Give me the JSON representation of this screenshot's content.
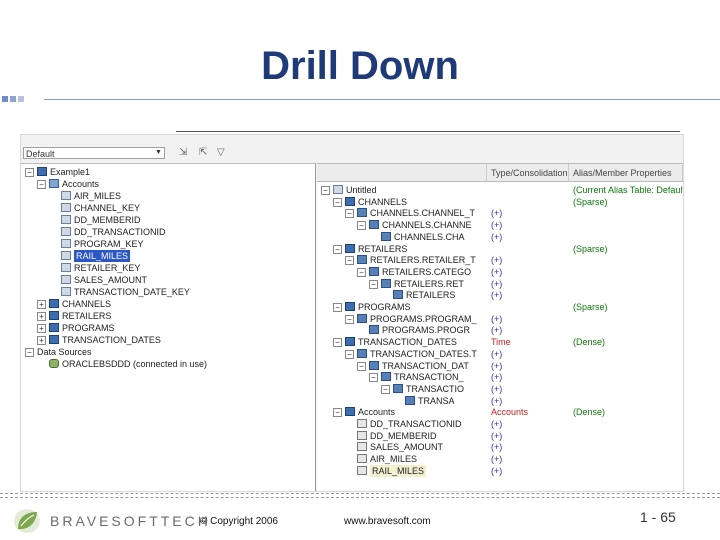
{
  "slide": {
    "title": "Drill Down",
    "colors": {
      "title": "#1f3a78",
      "squares": [
        "#6f8bc6",
        "#8fa4cf",
        "#b7c3de"
      ]
    }
  },
  "editor": {
    "dropdown_value": "Default",
    "toolbar_icons": [
      "expand-icon",
      "collapse-icon",
      "filter-icon"
    ],
    "left_tree": [
      {
        "label": "Example1",
        "level": 0,
        "icon": "cube-icon",
        "exp": "-"
      },
      {
        "label": "Accounts",
        "level": 1,
        "icon": "dimension-icon",
        "exp": "-"
      },
      {
        "label": "AIR_MILES",
        "level": 2,
        "icon": "member-icon"
      },
      {
        "label": "CHANNEL_KEY",
        "level": 2,
        "icon": "member-icon"
      },
      {
        "label": "DD_MEMBERID",
        "level": 2,
        "icon": "member-icon"
      },
      {
        "label": "DD_TRANSACTIONID",
        "level": 2,
        "icon": "member-icon"
      },
      {
        "label": "PROGRAM_KEY",
        "level": 2,
        "icon": "member-icon"
      },
      {
        "label": "RAIL_MILES",
        "level": 2,
        "icon": "member-icon",
        "selected": true
      },
      {
        "label": "RETAILER_KEY",
        "level": 2,
        "icon": "member-icon"
      },
      {
        "label": "SALES_AMOUNT",
        "level": 2,
        "icon": "member-icon"
      },
      {
        "label": "TRANSACTION_DATE_KEY",
        "level": 2,
        "icon": "member-icon"
      },
      {
        "label": "CHANNELS",
        "level": 1,
        "icon": "cube-icon",
        "exp": "+"
      },
      {
        "label": "RETAILERS",
        "level": 1,
        "icon": "cube-icon",
        "exp": "+"
      },
      {
        "label": "PROGRAMS",
        "level": 1,
        "icon": "cube-icon",
        "exp": "+"
      },
      {
        "label": "TRANSACTION_DATES",
        "level": 1,
        "icon": "cube-icon",
        "exp": "+"
      },
      {
        "label": "Data Sources",
        "level": 0,
        "icon": "",
        "exp": "-"
      },
      {
        "label": "ORACLEBSDDD (connected in use)",
        "level": 1,
        "icon": "database-icon"
      }
    ],
    "right_header": {
      "name": "",
      "type": "Type/Consolidation",
      "alias": "Alias/Member Properties"
    },
    "right_tree": [
      {
        "label": "Untitled",
        "level": 0,
        "icon": "outline-icon",
        "exp": "-",
        "type": "",
        "alias": "(Current Alias Table: Default)"
      },
      {
        "label": "CHANNELS",
        "level": 1,
        "icon": "cube-icon",
        "exp": "-",
        "type": "",
        "alias": "(Sparse)"
      },
      {
        "label": "CHANNELS.CHANNEL_T",
        "level": 2,
        "icon": "level-icon",
        "exp": "-",
        "type": "(+)",
        "alias": ""
      },
      {
        "label": "CHANNELS.CHANNE",
        "level": 3,
        "icon": "level-icon",
        "exp": "-",
        "type": "(+)",
        "alias": ""
      },
      {
        "label": "CHANNELS.CHA",
        "level": 4,
        "icon": "level-icon",
        "type": "(+)",
        "alias": ""
      },
      {
        "label": "RETAILERS",
        "level": 1,
        "icon": "cube-icon",
        "exp": "-",
        "type": "",
        "alias": "(Sparse)"
      },
      {
        "label": "RETAILERS.RETAILER_T",
        "level": 2,
        "icon": "level-icon",
        "exp": "-",
        "type": "(+)",
        "alias": ""
      },
      {
        "label": "RETAILERS.CATEGO",
        "level": 3,
        "icon": "level-icon",
        "exp": "-",
        "type": "(+)",
        "alias": ""
      },
      {
        "label": "RETAILERS.RET",
        "level": 4,
        "icon": "level-icon",
        "exp": "-",
        "type": "(+)",
        "alias": ""
      },
      {
        "label": "RETAILERS",
        "level": 5,
        "icon": "level-icon",
        "type": "(+)",
        "alias": ""
      },
      {
        "label": "PROGRAMS",
        "level": 1,
        "icon": "cube-icon",
        "exp": "-",
        "type": "",
        "alias": "(Sparse)"
      },
      {
        "label": "PROGRAMS.PROGRAM_",
        "level": 2,
        "icon": "level-icon",
        "exp": "-",
        "type": "(+)",
        "alias": ""
      },
      {
        "label": "PROGRAMS.PROGR",
        "level": 3,
        "icon": "level-icon",
        "type": "(+)",
        "alias": ""
      },
      {
        "label": "TRANSACTION_DATES",
        "level": 1,
        "icon": "cube-icon",
        "exp": "-",
        "type": "Time",
        "typeRed": true,
        "alias": "(Dense)"
      },
      {
        "label": "TRANSACTION_DATES.T",
        "level": 2,
        "icon": "level-icon",
        "exp": "-",
        "type": "(+)",
        "alias": ""
      },
      {
        "label": "TRANSACTION_DAT",
        "level": 3,
        "icon": "level-icon",
        "exp": "-",
        "type": "(+)",
        "alias": ""
      },
      {
        "label": "TRANSACTION_",
        "level": 4,
        "icon": "level-icon",
        "exp": "-",
        "type": "(+)",
        "alias": ""
      },
      {
        "label": "TRANSACTIO",
        "level": 5,
        "icon": "level-icon",
        "exp": "-",
        "type": "(+)",
        "alias": ""
      },
      {
        "label": "TRANSA",
        "level": 6,
        "icon": "level-icon",
        "type": "(+)",
        "alias": ""
      },
      {
        "label": "Accounts",
        "level": 1,
        "icon": "cube-icon",
        "exp": "-",
        "type": "Accounts",
        "typeRed": true,
        "alias": "(Dense)"
      },
      {
        "label": "DD_TRANSACTIONID",
        "level": 2,
        "icon": "account-icon",
        "type": "(+)",
        "alias": ""
      },
      {
        "label": "DD_MEMBERID",
        "level": 2,
        "icon": "account-icon",
        "type": "(+)",
        "alias": ""
      },
      {
        "label": "SALES_AMOUNT",
        "level": 2,
        "icon": "account-icon",
        "type": "(+)",
        "alias": ""
      },
      {
        "label": "AIR_MILES",
        "level": 2,
        "icon": "account-icon",
        "type": "(+)",
        "alias": ""
      },
      {
        "label": "RAIL_MILES",
        "level": 2,
        "icon": "account-icon",
        "type": "(+)",
        "alias": "",
        "highlight": true
      }
    ]
  },
  "footer": {
    "logo_text": "BRAVESOFTTECH",
    "copyright": "© Copyright 2006",
    "website": "www.bravesoft.com",
    "page": "1 - 65"
  }
}
